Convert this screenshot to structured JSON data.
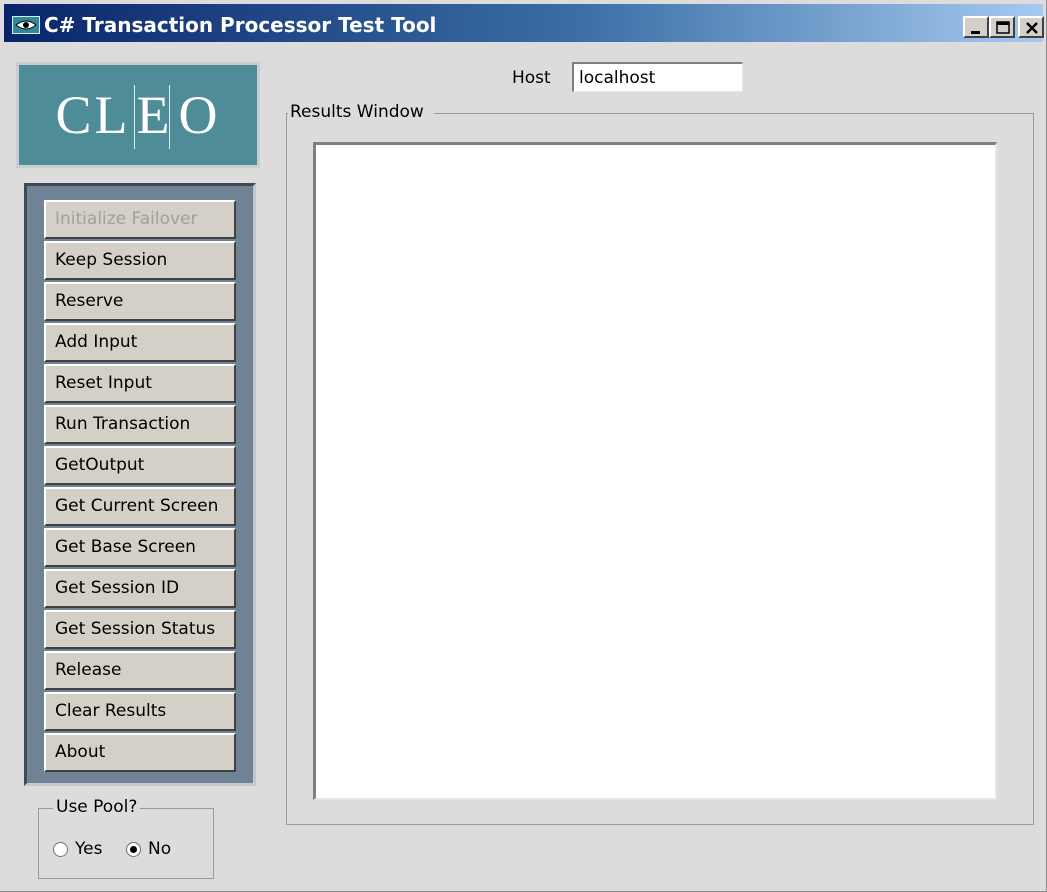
{
  "window": {
    "title": "C# Transaction Processor Test Tool",
    "app_icon": "eye-icon",
    "controls": {
      "minimize": "minimize-icon",
      "maximize": "maximize-icon",
      "close": "close-icon"
    }
  },
  "logo": {
    "text_parts": [
      "CL",
      "E",
      "O"
    ]
  },
  "buttons": [
    {
      "label": "Initialize Failover",
      "enabled": false
    },
    {
      "label": "Keep Session",
      "enabled": true
    },
    {
      "label": "Reserve",
      "enabled": true
    },
    {
      "label": "Add Input",
      "enabled": true
    },
    {
      "label": "Reset Input",
      "enabled": true
    },
    {
      "label": "Run Transaction",
      "enabled": true
    },
    {
      "label": "GetOutput",
      "enabled": true
    },
    {
      "label": "Get Current Screen",
      "enabled": true
    },
    {
      "label": "Get Base Screen",
      "enabled": true
    },
    {
      "label": "Get Session ID",
      "enabled": true
    },
    {
      "label": "Get Session Status",
      "enabled": true
    },
    {
      "label": "Release",
      "enabled": true
    },
    {
      "label": "Clear Results",
      "enabled": true
    },
    {
      "label": "About",
      "enabled": true
    }
  ],
  "host": {
    "label": "Host",
    "value": "localhost"
  },
  "results": {
    "label": "Results Window",
    "content": ""
  },
  "pool": {
    "label": "Use Pool?",
    "yes_label": "Yes",
    "no_label": "No",
    "selected": "No"
  },
  "colors": {
    "titlebar_start": "#0a246a",
    "titlebar_end": "#a6caf0",
    "logo_bg": "#4e8c97",
    "button_panel_bg": "#6f8394",
    "window_bg": "#dcdcdc"
  }
}
